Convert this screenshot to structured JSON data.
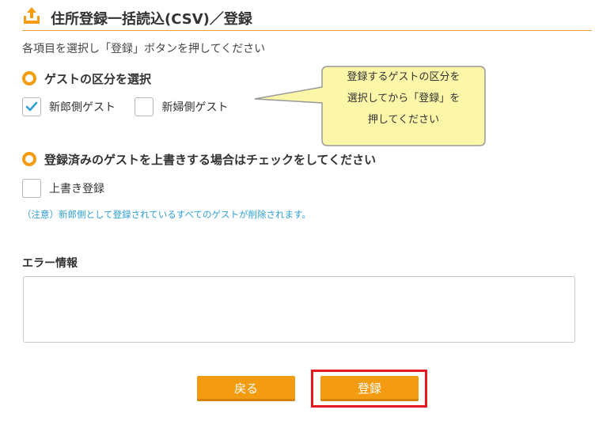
{
  "header": {
    "title": "住所登録一括読込(CSV)／登録",
    "icon": "upload-icon",
    "accent_color": "#f39c12"
  },
  "instruction": "各項目を選択し「登録」ボタンを押してください",
  "guest_section": {
    "heading": "ゲストの区分を選択",
    "options": [
      {
        "label": "新郎側ゲスト",
        "checked": true
      },
      {
        "label": "新婦側ゲスト",
        "checked": false
      }
    ]
  },
  "tooltip": {
    "lines": [
      "登録するゲストの区分を",
      "選択してから「登録」を",
      "押してください"
    ]
  },
  "overwrite_section": {
    "heading": "登録済みのゲストを上書きする場合はチェックをしてください",
    "option": {
      "label": "上書き登録",
      "checked": false
    },
    "note": "（注意）新郎側として登録されているすべてのゲストが削除されます。"
  },
  "error": {
    "label": "エラー情報",
    "value": ""
  },
  "buttons": {
    "back_label": "戻る",
    "register_label": "登録"
  }
}
